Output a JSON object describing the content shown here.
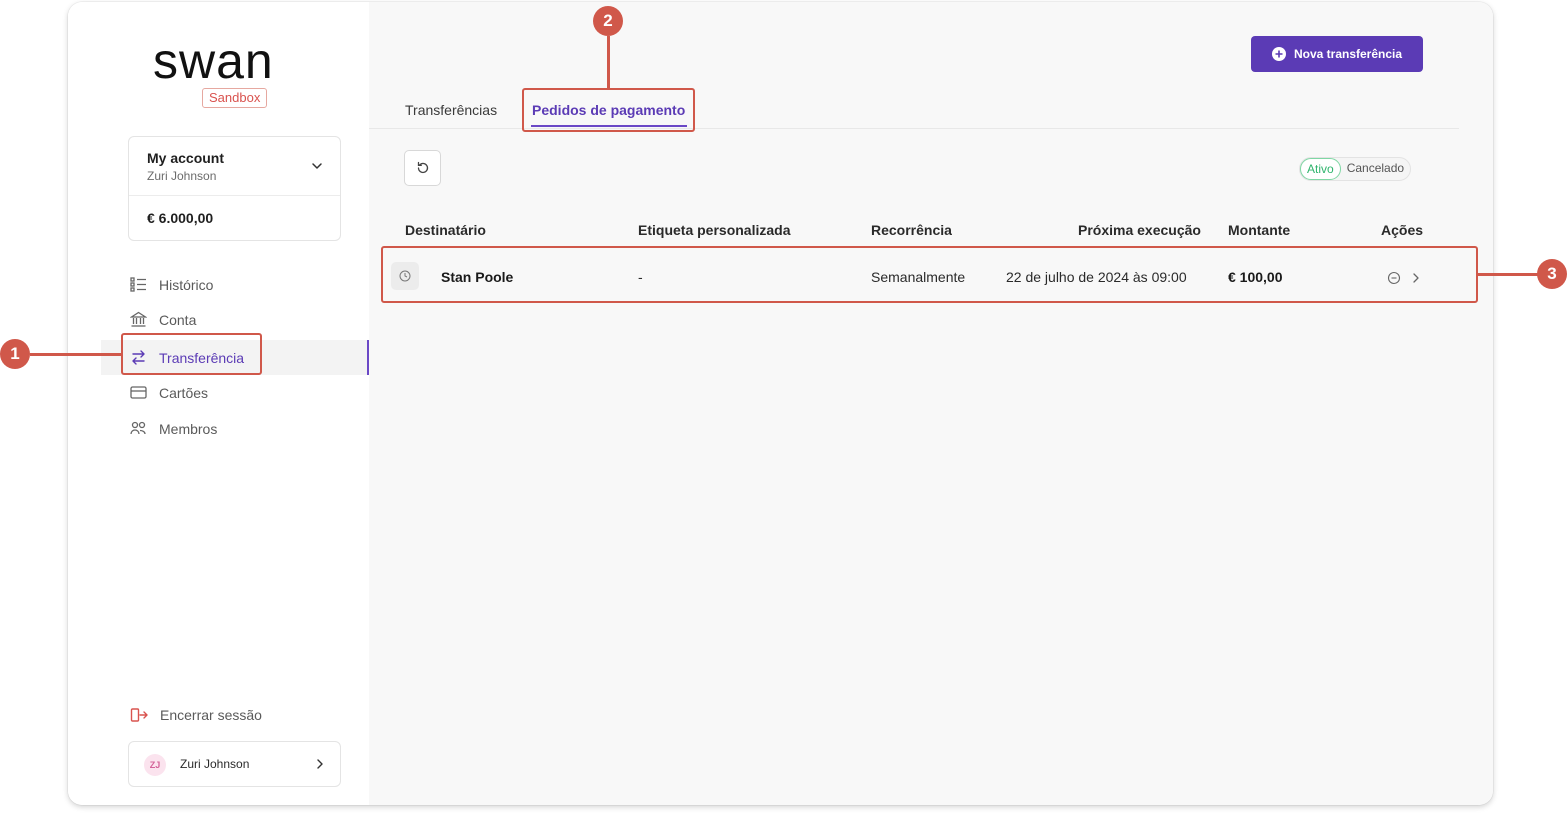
{
  "brand": {
    "logo": "swan",
    "env_badge": "Sandbox"
  },
  "account": {
    "name": "My account",
    "holder": "Zuri Johnson",
    "balance": "€ 6.000,00"
  },
  "nav": {
    "items": [
      {
        "label": "Histórico",
        "icon": "history-list-icon"
      },
      {
        "label": "Conta",
        "icon": "bank-icon"
      },
      {
        "label": "Transferência",
        "icon": "transfer-arrows-icon",
        "active": true
      },
      {
        "label": "Cartões",
        "icon": "card-icon"
      },
      {
        "label": "Membros",
        "icon": "members-icon"
      }
    ],
    "logout": "Encerrar sessão"
  },
  "user": {
    "initials": "ZJ",
    "name": "Zuri Johnson"
  },
  "header": {
    "new_transfer": "Nova transferência"
  },
  "tabs": [
    {
      "label": "Transferências",
      "active": false
    },
    {
      "label": "Pedidos de pagamento",
      "active": true
    }
  ],
  "filter": {
    "active": "Ativo",
    "cancelled": "Cancelado"
  },
  "table": {
    "columns": [
      "Destinatário",
      "Etiqueta personalizada",
      "Recorrência",
      "Próxima execução",
      "Montante",
      "Ações"
    ],
    "rows": [
      {
        "recipient": "Stan Poole",
        "label": "-",
        "recurrence": "Semanalmente",
        "next": "22 de julho de 2024 às 09:00",
        "amount": "€ 100,00"
      }
    ]
  },
  "annotations": [
    "1",
    "2",
    "3"
  ],
  "colors": {
    "accent": "#5b3bb5",
    "annotation": "#d0584a",
    "active_green": "#2fb46d"
  }
}
